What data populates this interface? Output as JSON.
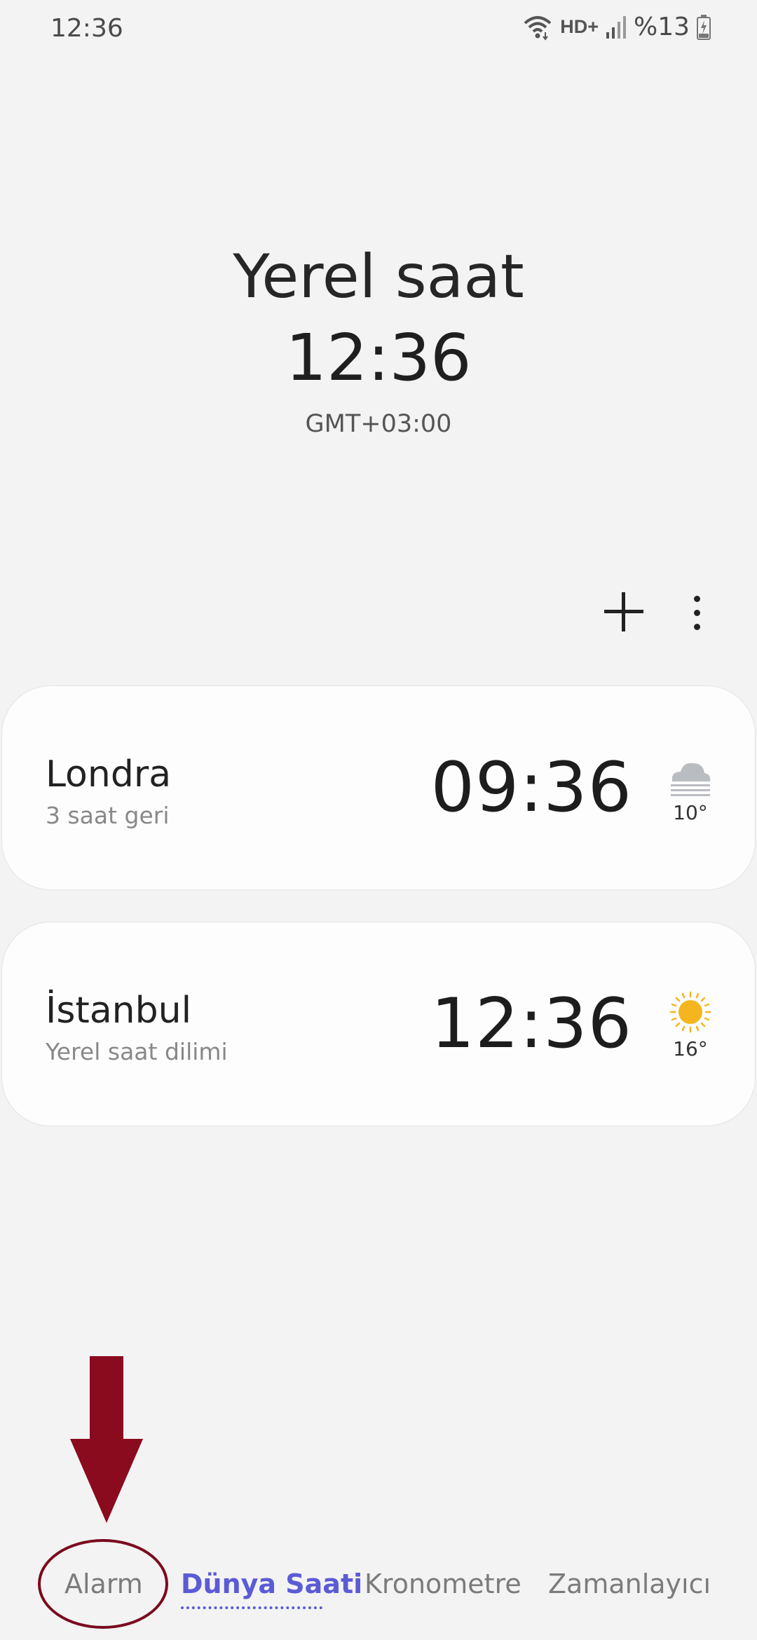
{
  "status_bar": {
    "time": "12:36",
    "network": "HD+",
    "battery": "%13",
    "icons": [
      "wifi-icon",
      "signal-icon",
      "battery-charging-icon"
    ]
  },
  "local": {
    "title": "Yerel saat",
    "time": "12:36",
    "offset": "GMT+03:00"
  },
  "toolbar": {
    "icons": [
      "plus-icon",
      "more-vertical-icon"
    ]
  },
  "cities": [
    {
      "name": "Londra",
      "subtitle": "3 saat geri",
      "time": "09:36",
      "weather_icon": "fog-cloud-icon",
      "temp": "10°"
    },
    {
      "name": "İstanbul",
      "subtitle": "Yerel saat dilimi",
      "time": "12:36",
      "weather_icon": "sun-icon",
      "temp": "16°"
    }
  ],
  "tabs": [
    {
      "label": "Alarm",
      "active": false
    },
    {
      "label": "Dünya Saati",
      "active": true
    },
    {
      "label": "Kronometre",
      "active": false
    },
    {
      "label": "Zamanlayıcı",
      "active": false
    }
  ],
  "colors": {
    "accent": "#5b5bd6",
    "annotation": "#8a0a1e",
    "sun": "#f5b51f",
    "cloud": "#b9bcc0"
  }
}
